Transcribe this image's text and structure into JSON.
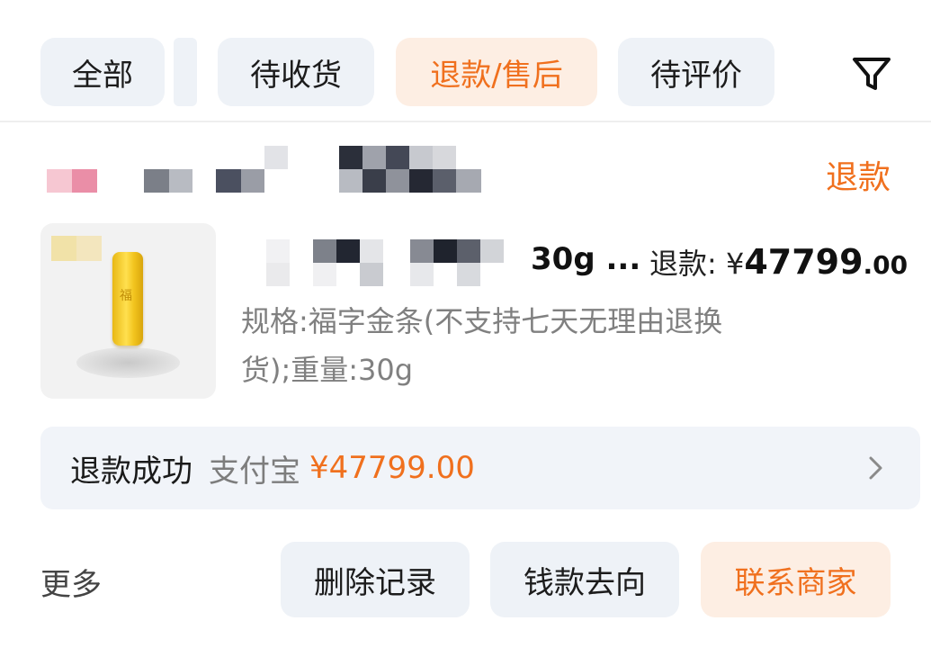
{
  "tabs": [
    {
      "label": "全部"
    },
    {
      "label": "待收货"
    },
    {
      "label": "退款/售后"
    },
    {
      "label": "待评价"
    }
  ],
  "filter_icon": "filter-icon",
  "order": {
    "status_label": "退款",
    "product": {
      "title_suffix": "30g ...",
      "refund_label": "退款:",
      "currency": "¥",
      "amount_int": "47799",
      "amount_dec": ".00",
      "spec": "规格:福字金条(不支持七天无理由退换货);重量:30g"
    },
    "refund_status": {
      "status": "退款成功",
      "method": "支付宝",
      "amount": "¥47799.00"
    }
  },
  "actions": {
    "more": "更多",
    "delete": "删除记录",
    "money_flow": "钱款去向",
    "contact": "联系商家"
  },
  "colors": {
    "accent": "#f0701e",
    "accent_bg": "#fdeee3",
    "chip_bg": "#eef2f7"
  }
}
